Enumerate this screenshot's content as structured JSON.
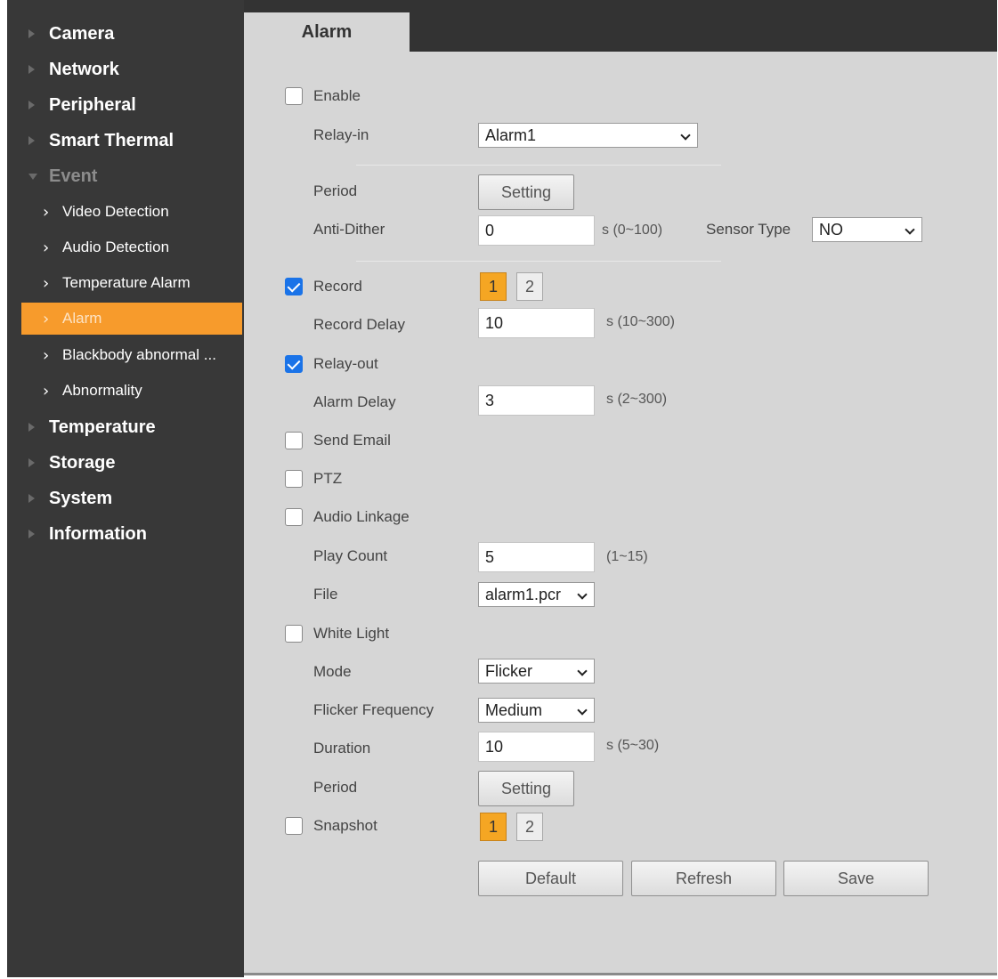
{
  "sidebar": {
    "items": [
      {
        "label": "Camera"
      },
      {
        "label": "Network"
      },
      {
        "label": "Peripheral"
      },
      {
        "label": "Smart Thermal"
      },
      {
        "label": "Event"
      },
      {
        "label": "Temperature"
      },
      {
        "label": "Storage"
      },
      {
        "label": "System"
      },
      {
        "label": "Information"
      }
    ],
    "event_subitems": [
      {
        "label": "Video Detection"
      },
      {
        "label": "Audio Detection"
      },
      {
        "label": "Temperature Alarm"
      },
      {
        "label": "Alarm"
      },
      {
        "label": "Blackbody abnormal ..."
      },
      {
        "label": "Abnormality"
      }
    ],
    "active_subitem": "Alarm"
  },
  "tab": {
    "label": "Alarm"
  },
  "form": {
    "enable": {
      "label": "Enable",
      "checked": false
    },
    "relay_in": {
      "label": "Relay-in",
      "value": "Alarm1"
    },
    "period": {
      "label": "Period",
      "button": "Setting"
    },
    "anti_dither": {
      "label": "Anti-Dither",
      "value": "0",
      "range": "s (0~100)"
    },
    "sensor_type": {
      "label": "Sensor Type",
      "value": "NO"
    },
    "record": {
      "label": "Record",
      "checked": true,
      "channels": [
        "1",
        "2"
      ],
      "selected": "1"
    },
    "record_delay": {
      "label": "Record Delay",
      "value": "10",
      "range": "s (10~300)"
    },
    "relay_out": {
      "label": "Relay-out",
      "checked": true
    },
    "alarm_delay": {
      "label": "Alarm Delay",
      "value": "3",
      "range": "s (2~300)"
    },
    "send_email": {
      "label": "Send Email",
      "checked": false
    },
    "ptz": {
      "label": "PTZ",
      "checked": false
    },
    "audio_linkage": {
      "label": "Audio Linkage",
      "checked": false
    },
    "play_count": {
      "label": "Play Count",
      "value": "5",
      "range": "(1~15)"
    },
    "file": {
      "label": "File",
      "value": "alarm1.pcr"
    },
    "white_light": {
      "label": "White Light",
      "checked": false
    },
    "mode": {
      "label": "Mode",
      "value": "Flicker"
    },
    "flicker_frequency": {
      "label": "Flicker Frequency",
      "value": "Medium"
    },
    "duration": {
      "label": "Duration",
      "value": "10",
      "range": "s (5~30)"
    },
    "period2": {
      "label": "Period",
      "button": "Setting"
    },
    "snapshot": {
      "label": "Snapshot",
      "checked": false,
      "channels": [
        "1",
        "2"
      ],
      "selected": "1"
    }
  },
  "actions": {
    "default": "Default",
    "refresh": "Refresh",
    "save": "Save"
  },
  "colors": {
    "sidebar_bg": "#383838",
    "active_item": "#f79b2c",
    "panel_bg": "#d6d6d6",
    "checkbox_checked": "#1a73e8",
    "channel_selected": "#f5a623"
  }
}
